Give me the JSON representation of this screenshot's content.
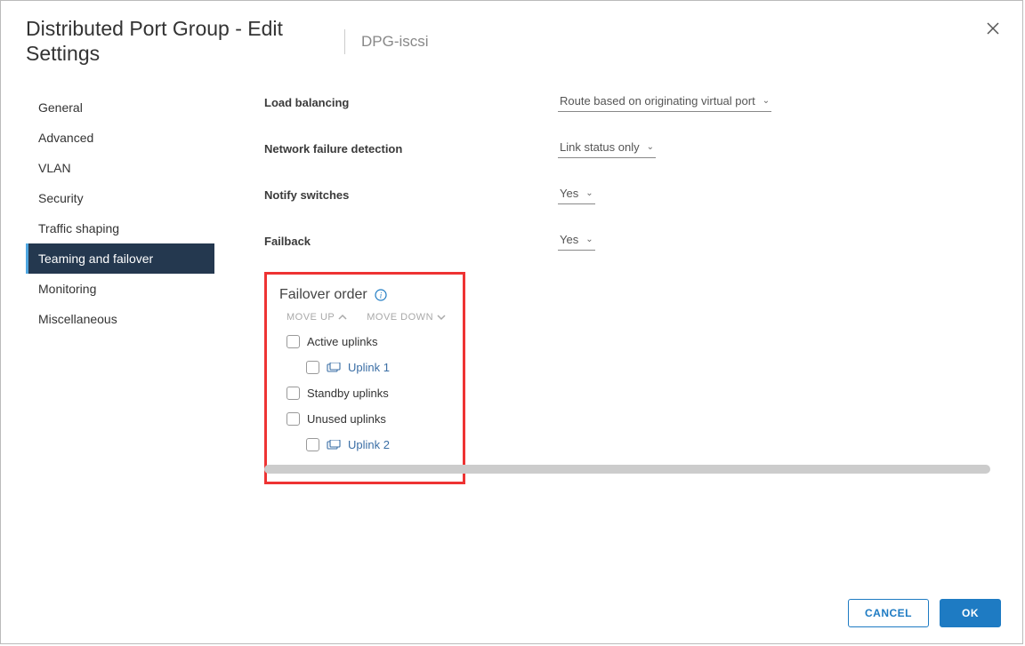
{
  "header": {
    "title": "Distributed Port Group - Edit Settings",
    "subtitle": "DPG-iscsi"
  },
  "sidebar": {
    "items": [
      {
        "label": "General",
        "active": false
      },
      {
        "label": "Advanced",
        "active": false
      },
      {
        "label": "VLAN",
        "active": false
      },
      {
        "label": "Security",
        "active": false
      },
      {
        "label": "Traffic shaping",
        "active": false
      },
      {
        "label": "Teaming and failover",
        "active": true
      },
      {
        "label": "Monitoring",
        "active": false
      },
      {
        "label": "Miscellaneous",
        "active": false
      }
    ]
  },
  "form": {
    "load_balancing": {
      "label": "Load balancing",
      "value": "Route based on originating virtual port"
    },
    "network_failure": {
      "label": "Network failure detection",
      "value": "Link status only"
    },
    "notify_switches": {
      "label": "Notify switches",
      "value": "Yes"
    },
    "failback": {
      "label": "Failback",
      "value": "Yes"
    }
  },
  "failover": {
    "title": "Failover order",
    "move_up": "MOVE UP",
    "move_down": "MOVE DOWN",
    "groups": {
      "active": {
        "label": "Active uplinks",
        "items": [
          "Uplink 1"
        ]
      },
      "standby": {
        "label": "Standby uplinks",
        "items": []
      },
      "unused": {
        "label": "Unused uplinks",
        "items": [
          "Uplink 2"
        ]
      }
    }
  },
  "footer": {
    "cancel": "CANCEL",
    "ok": "OK"
  }
}
